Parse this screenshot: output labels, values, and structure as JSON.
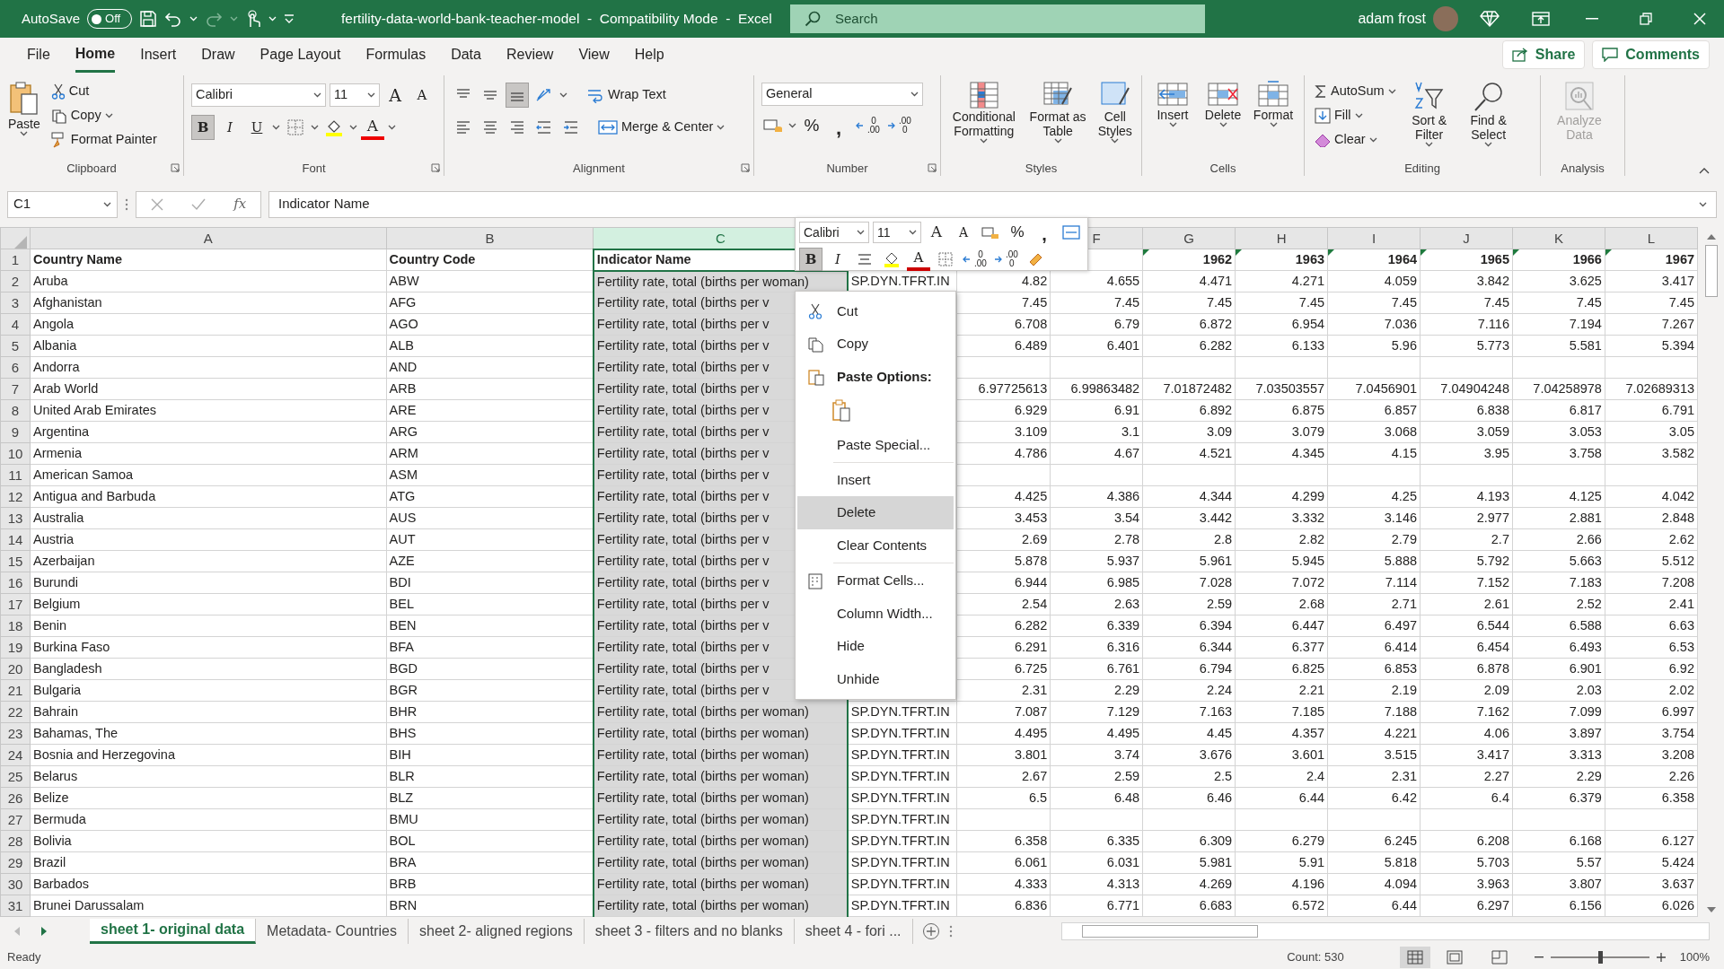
{
  "title_bar": {
    "autosave_label": "AutoSave",
    "autosave": {
      "on": false,
      "label": "Off"
    },
    "title": "fertility-data-world-bank-teacher-model  -  Compatibility Mode  -  Excel",
    "search_placeholder": "Search",
    "user": "adam frost"
  },
  "ribbon_tabs": [
    {
      "label": "File",
      "selected": false
    },
    {
      "label": "Home",
      "selected": true
    },
    {
      "label": "Insert",
      "selected": false
    },
    {
      "label": "Draw",
      "selected": false
    },
    {
      "label": "Page Layout",
      "selected": false
    },
    {
      "label": "Formulas",
      "selected": false
    },
    {
      "label": "Data",
      "selected": false
    },
    {
      "label": "Review",
      "selected": false
    },
    {
      "label": "View",
      "selected": false
    },
    {
      "label": "Help",
      "selected": false
    }
  ],
  "share_label": "Share",
  "comments_label": "Comments",
  "ribbon": {
    "clipboard": {
      "paste": "Paste",
      "cut": "Cut",
      "copy": "Copy",
      "format_painter": "Format Painter",
      "label": "Clipboard"
    },
    "font": {
      "name": "Calibri",
      "size": "11",
      "grow": "A",
      "shrink": "A",
      "styles": [
        {
          "label": "B",
          "on": true
        },
        {
          "label": "I",
          "on": false
        },
        {
          "label": "U",
          "on": false
        }
      ],
      "color_letter": "A",
      "label": "Font"
    },
    "alignment": {
      "vertical": [
        {
          "on": false
        },
        {
          "on": false
        },
        {
          "on": true
        }
      ],
      "wrap_text": "Wrap Text",
      "merge": "Merge & Center",
      "label": "Alignment"
    },
    "number": {
      "format": "General",
      "percent": "%",
      "comma": ",",
      "decimals": [
        {
          "lines": [
            "0",
            ".00"
          ]
        },
        {
          "lines": [
            ".00",
            "0"
          ]
        }
      ],
      "label": "Number"
    },
    "styles": {
      "buttons": [
        "Conditional Formatting",
        "Format as Table",
        "Cell Styles"
      ],
      "label": "Styles"
    },
    "cells": {
      "buttons": [
        "Insert",
        "Delete",
        "Format"
      ],
      "label": "Cells"
    },
    "editing": {
      "autosum": "AutoSum",
      "fill": "Fill",
      "clear": "Clear",
      "sort": "Sort & Filter",
      "find": "Find & Select",
      "label": "Editing"
    },
    "analysis": {
      "button": "Analyze Data",
      "disabled": true,
      "label": "Analysis"
    }
  },
  "formula_bar": {
    "name_box": "C1",
    "function_label": "fx",
    "formula": "Indicator Name"
  },
  "columns": [
    {
      "header": "A",
      "kind": "text",
      "selected": false
    },
    {
      "header": "B",
      "kind": "text",
      "selected": false
    },
    {
      "header": "C",
      "kind": "text",
      "selected": true
    },
    {
      "kind": "text",
      "selected": false
    },
    {
      "kind": "number",
      "selected": false
    },
    {
      "header": "F",
      "kind": "number",
      "selected": false
    },
    {
      "header": "G",
      "kind": "number",
      "selected": false
    },
    {
      "header": "H",
      "kind": "number",
      "selected": false
    },
    {
      "header": "I",
      "kind": "number",
      "selected": false
    },
    {
      "header": "J",
      "kind": "number",
      "selected": false
    },
    {
      "header": "K",
      "kind": "number",
      "selected": false
    },
    {
      "header": "L",
      "kind": "number",
      "selected": false
    }
  ],
  "header_row": {
    "header": "1",
    "cells": [
      {
        "text": "Country Name",
        "flagged": false,
        "active": false
      },
      {
        "text": "Country Code",
        "flagged": false,
        "active": false
      },
      {
        "text": "Indicator Name",
        "flagged": false,
        "active": true
      },
      null,
      null,
      null,
      {
        "text": "1962",
        "flagged": true,
        "active": false
      },
      {
        "text": "1963",
        "flagged": true,
        "active": false
      },
      {
        "text": "1964",
        "flagged": true,
        "active": false
      },
      {
        "text": "1965",
        "flagged": true,
        "active": false
      },
      {
        "text": "1966",
        "flagged": true,
        "active": false
      },
      {
        "text": "1967",
        "flagged": true,
        "active": false
      }
    ]
  },
  "rows": [
    {
      "header": "2",
      "cells": [
        "Aruba",
        "ABW",
        "Fertility rate, total (births per woman)",
        "SP.DYN.TFRT.IN",
        "4.82",
        "4.655",
        "4.471",
        "4.271",
        "4.059",
        "3.842",
        "3.625",
        "3.417"
      ]
    },
    {
      "header": "3",
      "cells": [
        "Afghanistan",
        "AFG",
        "Fertility rate, total (births per v",
        null,
        "7.45",
        "7.45",
        "7.45",
        "7.45",
        "7.45",
        "7.45",
        "7.45",
        "7.45"
      ]
    },
    {
      "header": "4",
      "cells": [
        "Angola",
        "AGO",
        "Fertility rate, total (births per v",
        null,
        "6.708",
        "6.79",
        "6.872",
        "6.954",
        "7.036",
        "7.116",
        "7.194",
        "7.267"
      ]
    },
    {
      "header": "5",
      "cells": [
        "Albania",
        "ALB",
        "Fertility rate, total (births per v",
        null,
        "6.489",
        "6.401",
        "6.282",
        "6.133",
        "5.96",
        "5.773",
        "5.581",
        "5.394"
      ]
    },
    {
      "header": "6",
      "cells": [
        "Andorra",
        "AND",
        "Fertility rate, total (births per v",
        null,
        null,
        null,
        null,
        null,
        null,
        null,
        null,
        null
      ]
    },
    {
      "header": "7",
      "cells": [
        "Arab World",
        "ARB",
        "Fertility rate, total (births per v",
        null,
        "6.97725613",
        "6.99863482",
        "7.01872482",
        "7.03503557",
        "7.0456901",
        "7.04904248",
        "7.04258978",
        "7.02689313"
      ]
    },
    {
      "header": "8",
      "cells": [
        "United Arab Emirates",
        "ARE",
        "Fertility rate, total (births per v",
        null,
        "6.929",
        "6.91",
        "6.892",
        "6.875",
        "6.857",
        "6.838",
        "6.817",
        "6.791"
      ]
    },
    {
      "header": "9",
      "cells": [
        "Argentina",
        "ARG",
        "Fertility rate, total (births per v",
        null,
        "3.109",
        "3.1",
        "3.09",
        "3.079",
        "3.068",
        "3.059",
        "3.053",
        "3.05"
      ]
    },
    {
      "header": "10",
      "cells": [
        "Armenia",
        "ARM",
        "Fertility rate, total (births per v",
        null,
        "4.786",
        "4.67",
        "4.521",
        "4.345",
        "4.15",
        "3.95",
        "3.758",
        "3.582"
      ]
    },
    {
      "header": "11",
      "cells": [
        "American Samoa",
        "ASM",
        "Fertility rate, total (births per v",
        null,
        null,
        null,
        null,
        null,
        null,
        null,
        null,
        null
      ]
    },
    {
      "header": "12",
      "cells": [
        "Antigua and Barbuda",
        "ATG",
        "Fertility rate, total (births per v",
        null,
        "4.425",
        "4.386",
        "4.344",
        "4.299",
        "4.25",
        "4.193",
        "4.125",
        "4.042"
      ]
    },
    {
      "header": "13",
      "cells": [
        "Australia",
        "AUS",
        "Fertility rate, total (births per v",
        null,
        "3.453",
        "3.54",
        "3.442",
        "3.332",
        "3.146",
        "2.977",
        "2.881",
        "2.848"
      ]
    },
    {
      "header": "14",
      "cells": [
        "Austria",
        "AUT",
        "Fertility rate, total (births per v",
        null,
        "2.69",
        "2.78",
        "2.8",
        "2.82",
        "2.79",
        "2.7",
        "2.66",
        "2.62"
      ]
    },
    {
      "header": "15",
      "cells": [
        "Azerbaijan",
        "AZE",
        "Fertility rate, total (births per v",
        null,
        "5.878",
        "5.937",
        "5.961",
        "5.945",
        "5.888",
        "5.792",
        "5.663",
        "5.512"
      ]
    },
    {
      "header": "16",
      "cells": [
        "Burundi",
        "BDI",
        "Fertility rate, total (births per v",
        null,
        "6.944",
        "6.985",
        "7.028",
        "7.072",
        "7.114",
        "7.152",
        "7.183",
        "7.208"
      ]
    },
    {
      "header": "17",
      "cells": [
        "Belgium",
        "BEL",
        "Fertility rate, total (births per v",
        null,
        "2.54",
        "2.63",
        "2.59",
        "2.68",
        "2.71",
        "2.61",
        "2.52",
        "2.41"
      ]
    },
    {
      "header": "18",
      "cells": [
        "Benin",
        "BEN",
        "Fertility rate, total (births per v",
        null,
        "6.282",
        "6.339",
        "6.394",
        "6.447",
        "6.497",
        "6.544",
        "6.588",
        "6.63"
      ]
    },
    {
      "header": "19",
      "cells": [
        "Burkina Faso",
        "BFA",
        "Fertility rate, total (births per v",
        null,
        "6.291",
        "6.316",
        "6.344",
        "6.377",
        "6.414",
        "6.454",
        "6.493",
        "6.53"
      ]
    },
    {
      "header": "20",
      "cells": [
        "Bangladesh",
        "BGD",
        "Fertility rate, total (births per v",
        null,
        "6.725",
        "6.761",
        "6.794",
        "6.825",
        "6.853",
        "6.878",
        "6.901",
        "6.92"
      ]
    },
    {
      "header": "21",
      "cells": [
        "Bulgaria",
        "BGR",
        "Fertility rate, total (births per v",
        null,
        "2.31",
        "2.29",
        "2.24",
        "2.21",
        "2.19",
        "2.09",
        "2.03",
        "2.02"
      ]
    },
    {
      "header": "22",
      "cells": [
        "Bahrain",
        "BHR",
        "Fertility rate, total (births per woman)",
        "SP.DYN.TFRT.IN",
        "7.087",
        "7.129",
        "7.163",
        "7.185",
        "7.188",
        "7.162",
        "7.099",
        "6.997"
      ]
    },
    {
      "header": "23",
      "cells": [
        "Bahamas, The",
        "BHS",
        "Fertility rate, total (births per woman)",
        "SP.DYN.TFRT.IN",
        "4.495",
        "4.495",
        "4.45",
        "4.357",
        "4.221",
        "4.06",
        "3.897",
        "3.754"
      ]
    },
    {
      "header": "24",
      "cells": [
        "Bosnia and Herzegovina",
        "BIH",
        "Fertility rate, total (births per woman)",
        "SP.DYN.TFRT.IN",
        "3.801",
        "3.74",
        "3.676",
        "3.601",
        "3.515",
        "3.417",
        "3.313",
        "3.208"
      ]
    },
    {
      "header": "25",
      "cells": [
        "Belarus",
        "BLR",
        "Fertility rate, total (births per woman)",
        "SP.DYN.TFRT.IN",
        "2.67",
        "2.59",
        "2.5",
        "2.4",
        "2.31",
        "2.27",
        "2.29",
        "2.26"
      ]
    },
    {
      "header": "26",
      "cells": [
        "Belize",
        "BLZ",
        "Fertility rate, total (births per woman)",
        "SP.DYN.TFRT.IN",
        "6.5",
        "6.48",
        "6.46",
        "6.44",
        "6.42",
        "6.4",
        "6.379",
        "6.358"
      ]
    },
    {
      "header": "27",
      "cells": [
        "Bermuda",
        "BMU",
        "Fertility rate, total (births per woman)",
        "SP.DYN.TFRT.IN",
        null,
        null,
        null,
        null,
        null,
        null,
        null,
        null
      ]
    },
    {
      "header": "28",
      "cells": [
        "Bolivia",
        "BOL",
        "Fertility rate, total (births per woman)",
        "SP.DYN.TFRT.IN",
        "6.358",
        "6.335",
        "6.309",
        "6.279",
        "6.245",
        "6.208",
        "6.168",
        "6.127"
      ]
    },
    {
      "header": "29",
      "cells": [
        "Brazil",
        "BRA",
        "Fertility rate, total (births per woman)",
        "SP.DYN.TFRT.IN",
        "6.061",
        "6.031",
        "5.981",
        "5.91",
        "5.818",
        "5.703",
        "5.57",
        "5.424"
      ]
    },
    {
      "header": "30",
      "cells": [
        "Barbados",
        "BRB",
        "Fertility rate, total (births per woman)",
        "SP.DYN.TFRT.IN",
        "4.333",
        "4.313",
        "4.269",
        "4.196",
        "4.094",
        "3.963",
        "3.807",
        "3.637"
      ]
    },
    {
      "header": "31",
      "cells": [
        "Brunei Darussalam",
        "BRN",
        "Fertility rate, total (births per woman)",
        "SP.DYN.TFRT.IN",
        "6.836",
        "6.771",
        "6.683",
        "6.572",
        "6.44",
        "6.297",
        "6.156",
        "6.026"
      ]
    }
  ],
  "mini_toolbar": {
    "font": "Calibri",
    "size": "11",
    "grow": "A",
    "shrink": "A",
    "percent": "%",
    "comma": ",",
    "styles": [
      {
        "label": "B",
        "on": true
      },
      {
        "label": "I",
        "on": false
      }
    ],
    "color_letter": "A",
    "decimals": [
      {
        "lines": [
          "0",
          ".00"
        ]
      },
      {
        "lines": [
          ".00",
          "0"
        ]
      }
    ]
  },
  "context_menu": [
    {
      "kind": "item",
      "label": "Cut",
      "selected": false
    },
    {
      "kind": "item",
      "label": "Copy",
      "selected": false
    },
    {
      "kind": "heading",
      "label": "Paste Options:"
    },
    {
      "kind": "paste-buttons"
    },
    {
      "kind": "item",
      "label": "Paste Special...",
      "selected": false
    },
    {
      "kind": "separator"
    },
    {
      "kind": "item",
      "label": "Insert",
      "selected": false
    },
    {
      "kind": "item",
      "label": "Delete",
      "selected": true
    },
    {
      "kind": "item",
      "label": "Clear Contents",
      "selected": false
    },
    {
      "kind": "separator"
    },
    {
      "kind": "item",
      "label": "Format Cells...",
      "selected": false
    },
    {
      "kind": "item",
      "label": "Column Width...",
      "selected": false
    },
    {
      "kind": "item",
      "label": "Hide",
      "selected": false
    },
    {
      "kind": "item",
      "label": "Unhide",
      "selected": false
    }
  ],
  "sheet_tabs": [
    {
      "label": "sheet 1- original data",
      "selected": true
    },
    {
      "label": "Metadata- Countries",
      "selected": false
    },
    {
      "label": "sheet 2- aligned regions",
      "selected": false
    },
    {
      "label": "sheet 3 - filters and no blanks",
      "selected": false
    },
    {
      "label": "sheet 4 - fori ...",
      "selected": false
    }
  ],
  "status_bar": {
    "status": "Ready",
    "count": "Count: 530",
    "zoom": {
      "level": 0.5,
      "label": "100%"
    }
  }
}
